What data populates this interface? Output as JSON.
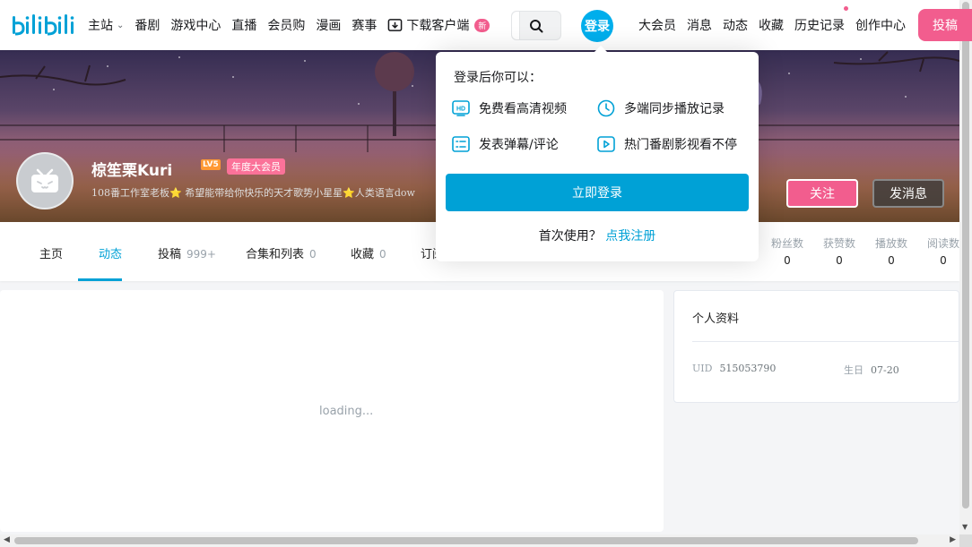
{
  "header": {
    "nav_left": [
      {
        "label": "主站"
      },
      {
        "label": "番剧"
      },
      {
        "label": "游戏中心"
      },
      {
        "label": "直播"
      },
      {
        "label": "会员购"
      },
      {
        "label": "漫画"
      },
      {
        "label": "赛事"
      }
    ],
    "download_label": "下载客户端",
    "download_badge": "新",
    "login_label": "登录",
    "nav_right": [
      {
        "label": "大会员"
      },
      {
        "label": "消息"
      },
      {
        "label": "动态"
      },
      {
        "label": "收藏"
      },
      {
        "label": "历史记录"
      },
      {
        "label": "创作中心"
      }
    ],
    "upload_label": "投稿"
  },
  "profile": {
    "username": "椋笙栗Kuri",
    "level": "LV5",
    "vip_label": "年度大会员",
    "sign": "108番工作室老板⭐ 希望能带给你快乐的天才歌势小星星⭐人类语言dow",
    "follow_label": "关注",
    "message_label": "发消息"
  },
  "tabs": [
    {
      "label": "主页",
      "count": ""
    },
    {
      "label": "动态",
      "count": ""
    },
    {
      "label": "投稿",
      "count": "999+"
    },
    {
      "label": "合集和列表",
      "count": "0"
    },
    {
      "label": "收藏",
      "count": "0"
    },
    {
      "label": "订阅",
      "count": ""
    }
  ],
  "stats": [
    {
      "label": "粉丝数",
      "value": "0"
    },
    {
      "label": "获赞数",
      "value": "0"
    },
    {
      "label": "播放数",
      "value": "0"
    },
    {
      "label": "阅读数",
      "value": "0"
    }
  ],
  "main": {
    "loading_text": "loading..."
  },
  "info": {
    "title": "个人资料",
    "uid_label": "UID",
    "uid_value": "515053790",
    "birthday_label": "生日",
    "birthday_value": "07-20"
  },
  "login_popover": {
    "title": "登录后你可以：",
    "perks": [
      {
        "label": "免费看高清视频",
        "icon": "hd-icon"
      },
      {
        "label": "多端同步播放记录",
        "icon": "clock-icon"
      },
      {
        "label": "发表弹幕/评论",
        "icon": "danmaku-icon"
      },
      {
        "label": "热门番剧影视看不停",
        "icon": "play-icon"
      }
    ],
    "login_button": "立即登录",
    "register_prompt": "首次使用？",
    "register_link": "点我注册"
  },
  "colors": {
    "accent": "#00a1d6",
    "pink": "#f25d8e"
  }
}
